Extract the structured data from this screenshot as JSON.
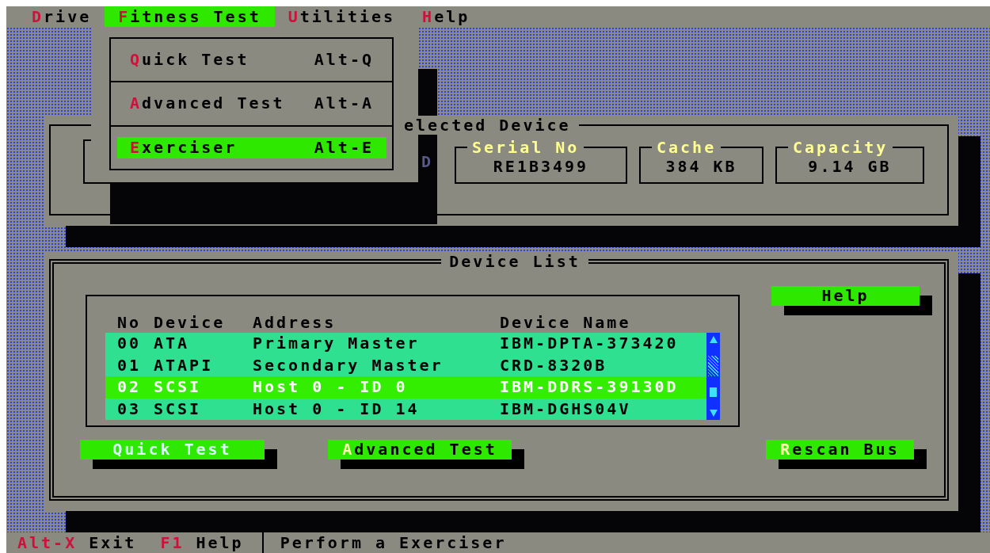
{
  "menu_bar": [
    {
      "label": "Drive",
      "selected": false
    },
    {
      "label": "Fitness Test",
      "selected": true
    },
    {
      "label": "Utilities",
      "selected": false
    },
    {
      "label": "Help",
      "selected": false
    }
  ],
  "menu": {
    "items": [
      {
        "label": "Quick Test",
        "shortcut": "Alt-Q",
        "selected": false
      },
      {
        "label": "Advanced Test",
        "shortcut": "Alt-A",
        "selected": false
      },
      {
        "label": "Exerciser",
        "shortcut": "Alt-E",
        "selected": true
      }
    ]
  },
  "selected_device": {
    "title": "elected Device",
    "partial_value": "D",
    "fields": [
      {
        "label": "Serial No",
        "value": "RE1B3499"
      },
      {
        "label": "Cache",
        "value": "384 KB"
      },
      {
        "label": "Capacity",
        "value": "9.14 GB"
      }
    ]
  },
  "device_list": {
    "title": "Device List",
    "columns": [
      "No",
      "Device",
      "Address",
      "Device Name"
    ],
    "rows": [
      {
        "no": "00",
        "device": "ATA",
        "address": "Primary Master",
        "name": "IBM-DPTA-373420",
        "selected": false
      },
      {
        "no": "01",
        "device": "ATAPI",
        "address": "Secondary Master",
        "name": "CRD-8320B",
        "selected": false
      },
      {
        "no": "02",
        "device": "SCSI",
        "address": "Host 0 - ID 0",
        "name": "IBM-DDRS-39130D",
        "selected": true
      },
      {
        "no": "03",
        "device": "SCSI",
        "address": "Host 0 - ID 14",
        "name": "IBM-DGHS04V",
        "selected": false
      }
    ],
    "help_button": {
      "label": "Help",
      "focused": false,
      "hotkey": false
    },
    "buttons": [
      {
        "label": "Quick Test",
        "focused": true,
        "hotkey": true
      },
      {
        "label": "Advanced Test",
        "focused": false,
        "hotkey": true
      },
      {
        "label": "Rescan Bus",
        "focused": false,
        "hotkey": true
      }
    ]
  },
  "status_bar": {
    "keys": [
      {
        "key": "Alt-X",
        "label": "Exit"
      },
      {
        "key": "F1",
        "label": "Help"
      }
    ],
    "message": "Perform a Exerciser"
  }
}
